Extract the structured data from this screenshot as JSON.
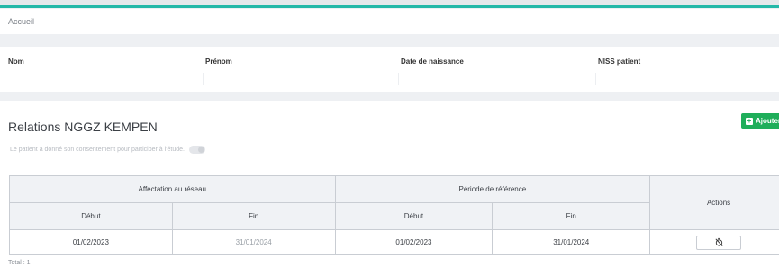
{
  "breadcrumb": "Accueil",
  "patient": {
    "fields": [
      {
        "label": "Nom"
      },
      {
        "label": "Prénom"
      },
      {
        "label": "Date de naissance"
      },
      {
        "label": "NISS patient"
      }
    ]
  },
  "relations": {
    "title": "Relations NGGZ KEMPEN",
    "add_label": "Ajouter",
    "consent_text": "Le patient a donné son consentement pour participer à l'étude.",
    "consent_checked": false,
    "table": {
      "group_headers": [
        "Affectation au réseau",
        "Période de référence",
        "Actions"
      ],
      "sub_headers": [
        "Début",
        "Fin",
        "Début",
        "Fin"
      ],
      "rows": [
        {
          "aff_debut": "01/02/2023",
          "aff_fin": "31/01/2024",
          "per_debut": "01/02/2023",
          "per_fin": "31/01/2024"
        }
      ]
    },
    "total": "Total : 1"
  },
  "colors": {
    "accent": "#25b8a8",
    "add_button": "#1fae5a"
  },
  "icons": {
    "action": "timer-off-icon",
    "add": "plus-square-icon"
  }
}
